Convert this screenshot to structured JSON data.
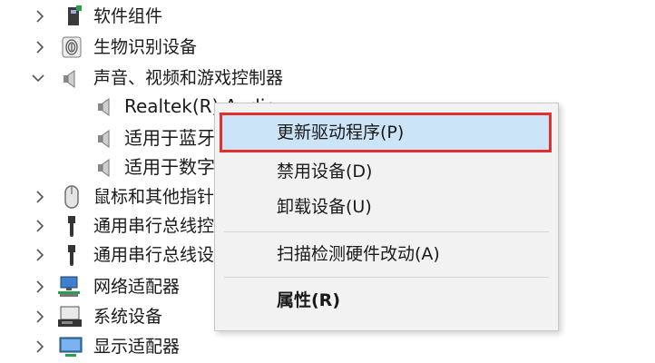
{
  "tree": {
    "items": [
      {
        "label": "软件组件",
        "expanded": false,
        "icon": "software-component-icon"
      },
      {
        "label": "生物识别设备",
        "expanded": false,
        "icon": "fingerprint-icon"
      },
      {
        "label": "声音、视频和游戏控制器",
        "expanded": true,
        "icon": "speaker-icon"
      },
      {
        "label": "Realtek(R) Audio",
        "child": true,
        "icon": "speaker-icon"
      },
      {
        "label": "适用于蓝牙",
        "child": true,
        "icon": "speaker-icon"
      },
      {
        "label": "适用于数字",
        "child": true,
        "icon": "speaker-icon"
      },
      {
        "label": "鼠标和其他指针",
        "expanded": false,
        "icon": "mouse-icon"
      },
      {
        "label": "通用串行总线控",
        "expanded": false,
        "icon": "usb-icon"
      },
      {
        "label": "通用串行总线设",
        "expanded": false,
        "icon": "usb-icon"
      },
      {
        "label": "网络适配器",
        "expanded": false,
        "icon": "network-adapter-icon"
      },
      {
        "label": "系统设备",
        "expanded": false,
        "icon": "system-device-icon"
      },
      {
        "label": "显示适配器",
        "expanded": false,
        "icon": "display-adapter-icon"
      }
    ]
  },
  "context_menu": {
    "items": [
      {
        "label": "更新驱动程序(P)",
        "highlighted": true
      },
      {
        "label": "禁用设备(D)"
      },
      {
        "label": "卸载设备(U)"
      },
      {
        "label": "扫描检测硬件改动(A)"
      },
      {
        "label": "属性(R)",
        "bold": true
      }
    ]
  },
  "colors": {
    "highlight_bg": "#cce4f7",
    "highlight_border": "#e0312f",
    "menu_bg": "#f2f2f2"
  }
}
